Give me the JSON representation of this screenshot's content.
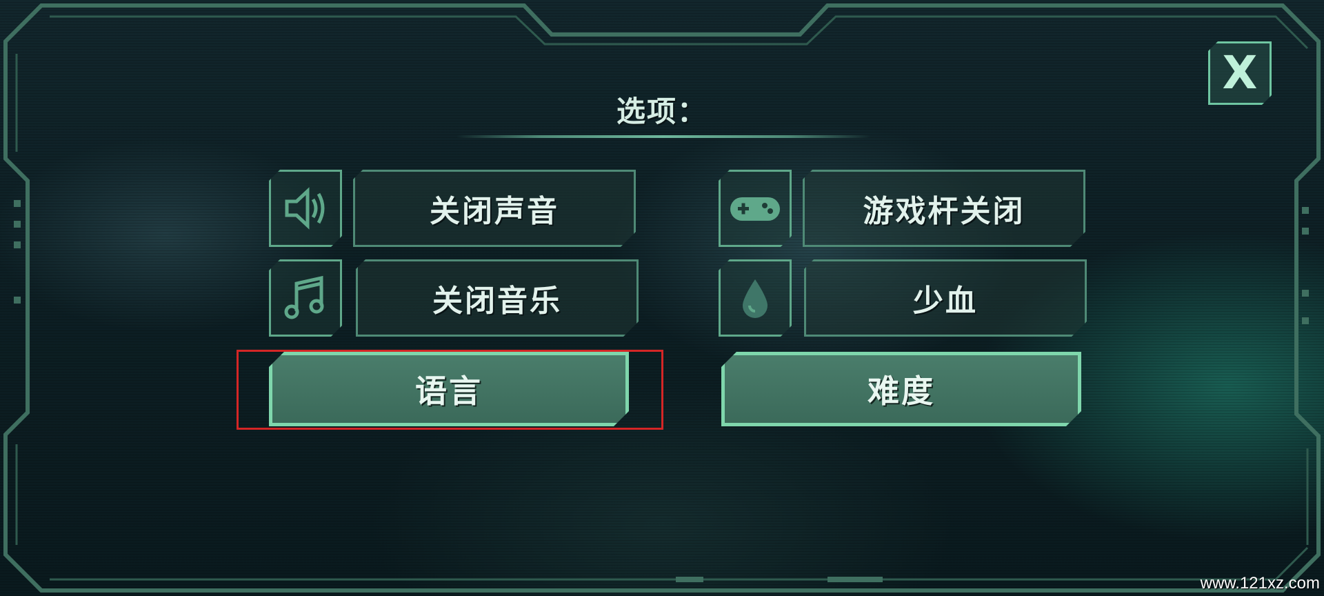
{
  "menu": {
    "title": "选项：",
    "close_label": "X"
  },
  "options": {
    "sound": {
      "label": "关闭声音",
      "icon": "speaker-icon"
    },
    "joystick": {
      "label": "游戏杆关闭",
      "icon": "gamepad-icon"
    },
    "music": {
      "label": "关闭音乐",
      "icon": "music-note-icon"
    },
    "blood": {
      "label": "少血",
      "icon": "blood-drop-icon"
    },
    "language": {
      "label": "语言"
    },
    "difficulty": {
      "label": "难度"
    }
  },
  "watermark": {
    "text": "www.121xz.com"
  },
  "colors": {
    "accent": "#7fd6ac",
    "frame": "#4f8a76",
    "highlight": "#d42626"
  }
}
